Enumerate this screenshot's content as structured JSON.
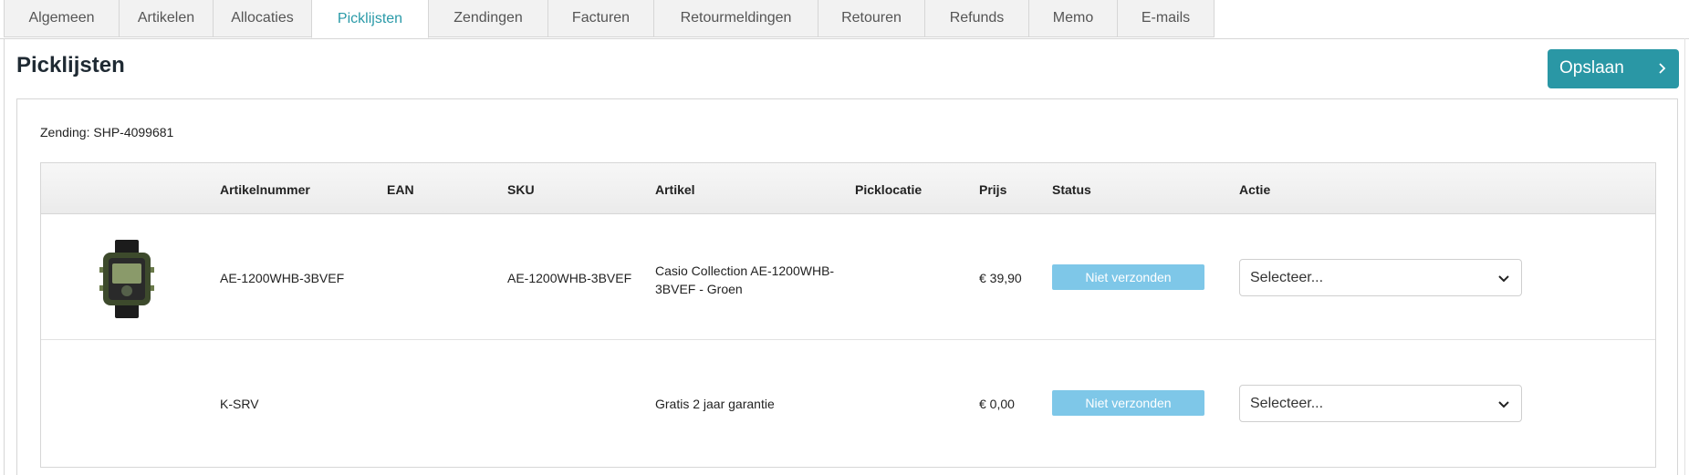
{
  "tabs": [
    {
      "label": "Algemeen",
      "active": false
    },
    {
      "label": "Artikelen",
      "active": false
    },
    {
      "label": "Allocaties",
      "active": false
    },
    {
      "label": "Picklijsten",
      "active": true
    },
    {
      "label": "Zendingen",
      "active": false
    },
    {
      "label": "Facturen",
      "active": false
    },
    {
      "label": "Retourmeldingen",
      "active": false
    },
    {
      "label": "Retouren",
      "active": false
    },
    {
      "label": "Refunds",
      "active": false
    },
    {
      "label": "Memo",
      "active": false
    },
    {
      "label": "E-mails",
      "active": false
    }
  ],
  "page": {
    "title": "Picklijsten",
    "save_label": "Opslaan",
    "save_icon": "chevron-right-icon",
    "accent_color": "#2a97a5"
  },
  "shipment": {
    "label": "Zending: SHP-4099681"
  },
  "table": {
    "columns": [
      "Artikelnummer",
      "EAN",
      "SKU",
      "Artikel",
      "Picklocatie",
      "Prijs",
      "Status",
      "Actie"
    ],
    "rows": [
      {
        "image": "watch-thumbnail",
        "article_number": "AE-1200WHB-3BVEF",
        "ean": "",
        "sku": "AE-1200WHB-3BVEF",
        "article_line1": "Casio Collection AE-1200WHB-",
        "article_line2": "3BVEF - Groen",
        "pick_location": "",
        "price": "€ 39,90",
        "status": "Niet verzonden",
        "action": "Selecteer..."
      },
      {
        "image": "",
        "article_number": "K-SRV",
        "ean": "",
        "sku": "",
        "article_line1": "Gratis 2 jaar garantie",
        "article_line2": "",
        "pick_location": "",
        "price": "€ 0,00",
        "status": "Niet verzonden",
        "action": "Selecteer..."
      }
    ],
    "status_color": "#7ec7e8"
  }
}
